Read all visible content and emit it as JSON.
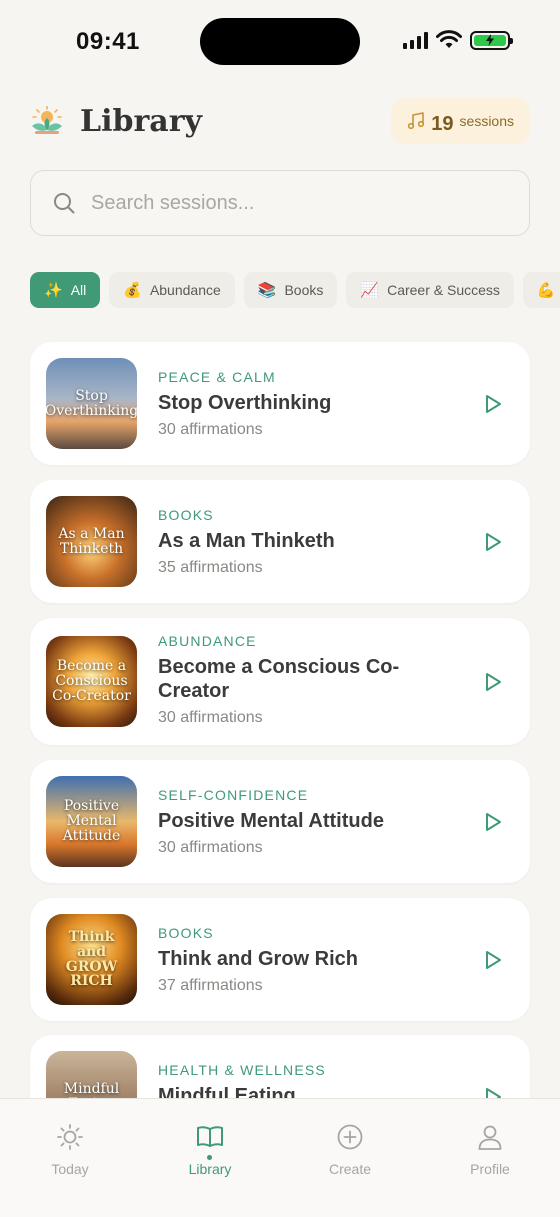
{
  "status_bar": {
    "time": "09:41"
  },
  "header": {
    "title": "Library",
    "sessions_count": "19",
    "sessions_label": "sessions"
  },
  "search": {
    "placeholder": "Search sessions..."
  },
  "categories": [
    {
      "emoji": "✨",
      "label": "All",
      "active": true
    },
    {
      "emoji": "💰",
      "label": "Abundance",
      "active": false
    },
    {
      "emoji": "📚",
      "label": "Books",
      "active": false
    },
    {
      "emoji": "📈",
      "label": "Career & Success",
      "active": false
    },
    {
      "emoji": "💪",
      "label": "",
      "active": false
    }
  ],
  "sessions": [
    {
      "category": "PEACE & CALM",
      "title": "Stop Overthinking",
      "count": "30 affirmations",
      "thumb_text": "Stop Overthinking"
    },
    {
      "category": "BOOKS",
      "title": "As a Man Thinketh",
      "count": "35 affirmations",
      "thumb_text": "As a Man Thinketh"
    },
    {
      "category": "ABUNDANCE",
      "title": "Become a Conscious Co-Creator",
      "count": "30 affirmations",
      "thumb_text": "Become a Conscious Co-Creator"
    },
    {
      "category": "SELF-CONFIDENCE",
      "title": "Positive Mental Attitude",
      "count": "30 affirmations",
      "thumb_text": "Positive Mental Attitude"
    },
    {
      "category": "BOOKS",
      "title": "Think and Grow Rich",
      "count": "37 affirmations",
      "thumb_text": "Think and GROW RICH"
    },
    {
      "category": "HEALTH & WELLNESS",
      "title": "Mindful Eating",
      "count": "",
      "thumb_text": "Mindful Eating"
    }
  ],
  "tabbar": [
    {
      "label": "Today",
      "icon": "sun-icon",
      "active": false
    },
    {
      "label": "Library",
      "icon": "book-icon",
      "active": true
    },
    {
      "label": "Create",
      "icon": "plus-circle-icon",
      "active": false
    },
    {
      "label": "Profile",
      "icon": "user-icon",
      "active": false
    }
  ],
  "colors": {
    "accent": "#3f9a75",
    "badge_bg": "#fbf1dc",
    "background": "#f6f5f2"
  }
}
